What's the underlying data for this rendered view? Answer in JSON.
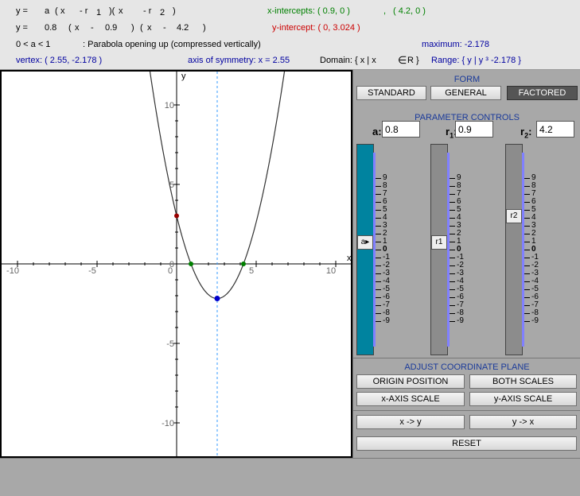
{
  "equations": {
    "general_form": [
      "y =",
      "a",
      "(",
      "x",
      "- r",
      "1",
      ")(",
      "x",
      "- r",
      "2",
      ")"
    ],
    "specific_form": [
      "y =",
      "0.8",
      "(",
      "x",
      "-",
      "0.9",
      ")",
      "(",
      "x",
      "-",
      "4.2",
      ")"
    ]
  },
  "info": {
    "x_intercepts_label": "x-intercepts: ( 0.9, 0 )",
    "x_intercepts_sep": ",",
    "x_intercepts_second": "( 4.2, 0 )",
    "y_intercept": "y-intercept: ( 0, 3.024 )",
    "a_condition": "0 < a < 1",
    "description": ": Parabola opening up (compressed vertically)",
    "extremum": "maximum: -2.178",
    "vertex": "vertex: ( 2.55, -2.178 )",
    "axis": "axis of symmetry: x = 2.55",
    "domain": "Domain: { x | x",
    "domain_set": "R }",
    "range": "Range: { y | y ³ -2.178 }"
  },
  "graph": {
    "x_axis_label": "x",
    "y_axis_label": "y",
    "x_ticks": [
      "-10",
      "-5",
      "0",
      "5",
      "10"
    ],
    "y_ticks": [
      "10",
      "5",
      "0",
      "-5",
      "-10"
    ],
    "origin_label": "0"
  },
  "chart_data": {
    "type": "line",
    "function": "y = 0.8(x - 0.9)(x - 4.2)",
    "a": 0.8,
    "r1": 0.9,
    "r2": 4.2,
    "xlim": [
      -11,
      11
    ],
    "ylim": [
      -12,
      12
    ],
    "vertex": {
      "x": 2.55,
      "y": -2.178
    },
    "x_intercepts": [
      {
        "x": 0.9,
        "y": 0
      },
      {
        "x": 4.2,
        "y": 0
      }
    ],
    "y_intercept": {
      "x": 0,
      "y": 3.024
    },
    "axis_of_symmetry": 2.55,
    "colors": {
      "curve": "#333333",
      "vertex": "#0000cc",
      "y_intercept": "#990000",
      "x_intercepts": "#008000",
      "axis": "#3399ff"
    }
  },
  "panel": {
    "form_header": "FORM",
    "form_buttons": [
      "STANDARD",
      "GENERAL",
      "FACTORED"
    ],
    "active_form": "FACTORED",
    "param_header": "PARAMETER CONTROLS",
    "params": [
      {
        "label": "a",
        "sub": "",
        "value": "0.8",
        "knob": "a"
      },
      {
        "label": "r",
        "sub": "1",
        "value": "0.9",
        "knob": "r1"
      },
      {
        "label": "r",
        "sub": "2",
        "value": "4.2",
        "knob": "r2"
      }
    ],
    "slider_ticks": [
      "9",
      "8",
      "7",
      "6",
      "5",
      "4",
      "3",
      "2",
      "1",
      "0",
      "-1",
      "-2",
      "-3",
      "-4",
      "-5",
      "-6",
      "-7",
      "-8",
      "-9"
    ],
    "coord_header": "ADJUST COORDINATE PLANE",
    "coord_buttons": [
      "ORIGIN POSITION",
      "BOTH SCALES",
      "x-AXIS SCALE",
      "y-AXIS SCALE"
    ],
    "swap_buttons": [
      "x -> y",
      "y -> x"
    ],
    "reset_label": "RESET"
  }
}
